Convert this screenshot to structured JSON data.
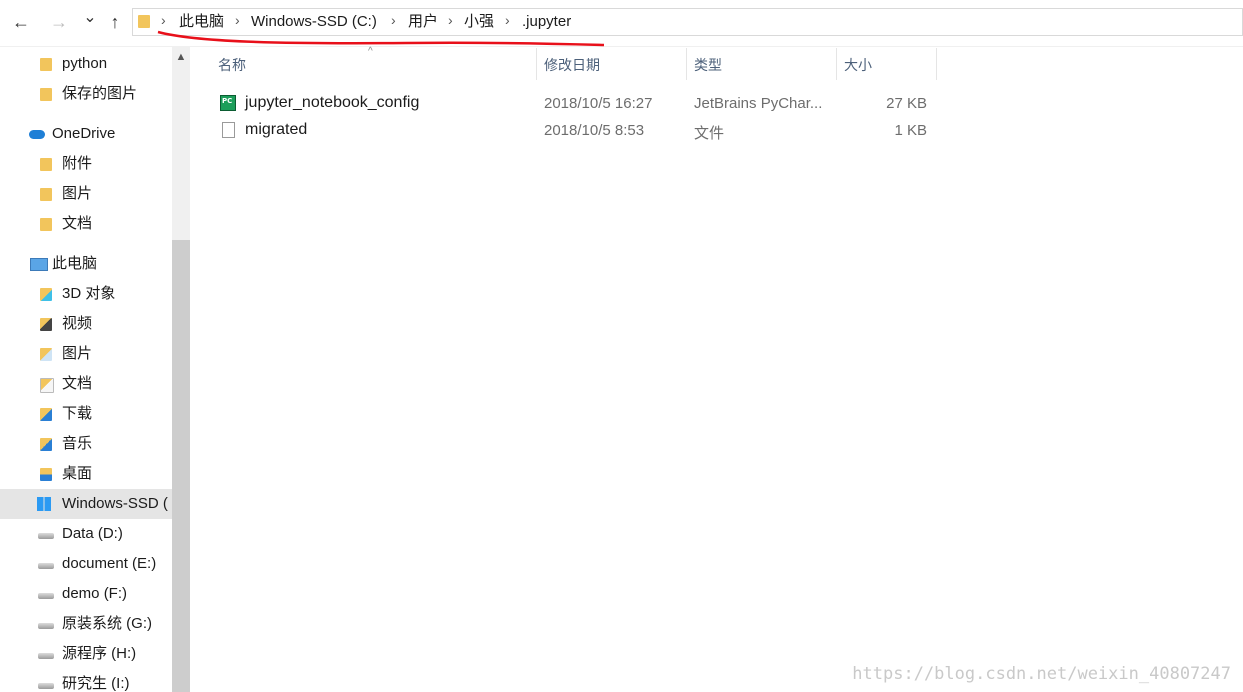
{
  "toolbar": {
    "back_glyph": "←",
    "forward_glyph": "→",
    "recent_glyph": "⌄",
    "up_glyph": "↑"
  },
  "breadcrumb": [
    "此电脑",
    "Windows-SSD (C:)",
    "用户",
    "小强",
    ".jupyter"
  ],
  "sidebar": {
    "items": [
      {
        "label": "python",
        "icon": "folder-icon"
      },
      {
        "label": "保存的图片",
        "icon": "folder-icon"
      },
      {
        "label": "OneDrive",
        "icon": "onedrive-cloud-icon"
      },
      {
        "label": "附件",
        "icon": "folder-icon"
      },
      {
        "label": "图片",
        "icon": "folder-icon"
      },
      {
        "label": "文档",
        "icon": "folder-icon"
      },
      {
        "label": "此电脑",
        "icon": "computer-icon"
      },
      {
        "label": "3D 对象",
        "icon": "3d-objects-icon"
      },
      {
        "label": "视频",
        "icon": "videos-icon"
      },
      {
        "label": "图片",
        "icon": "pictures-icon"
      },
      {
        "label": "文档",
        "icon": "documents-icon"
      },
      {
        "label": "下载",
        "icon": "downloads-icon"
      },
      {
        "label": "音乐",
        "icon": "music-icon"
      },
      {
        "label": "桌面",
        "icon": "desktop-icon"
      },
      {
        "label": "Windows-SSD (",
        "icon": "windows-drive-icon",
        "selected": true
      },
      {
        "label": "Data (D:)",
        "icon": "drive-icon"
      },
      {
        "label": "document (E:)",
        "icon": "drive-icon"
      },
      {
        "label": "demo (F:)",
        "icon": "drive-icon"
      },
      {
        "label": "原装系统 (G:)",
        "icon": "drive-icon"
      },
      {
        "label": "源程序 (H:)",
        "icon": "drive-icon"
      },
      {
        "label": "研究生 (I:)",
        "icon": "drive-icon"
      }
    ]
  },
  "columns": {
    "name": "名称",
    "modified": "修改日期",
    "type": "类型",
    "size": "大小"
  },
  "files": [
    {
      "name": "jupyter_notebook_config",
      "modified": "2018/10/5 16:27",
      "type": "JetBrains PyChar...",
      "size": "27 KB",
      "icon": "pycharm-file-icon"
    },
    {
      "name": "migrated",
      "modified": "2018/10/5 8:53",
      "type": "文件",
      "size": "1 KB",
      "icon": "blank-file-icon"
    }
  ],
  "watermark": "https://blog.csdn.net/weixin_40807247",
  "colors": {
    "annotation": "#e8101a",
    "selected_bg": "#e5e5e5",
    "folder": "#f2c55c",
    "header_text": "#4c607a"
  }
}
